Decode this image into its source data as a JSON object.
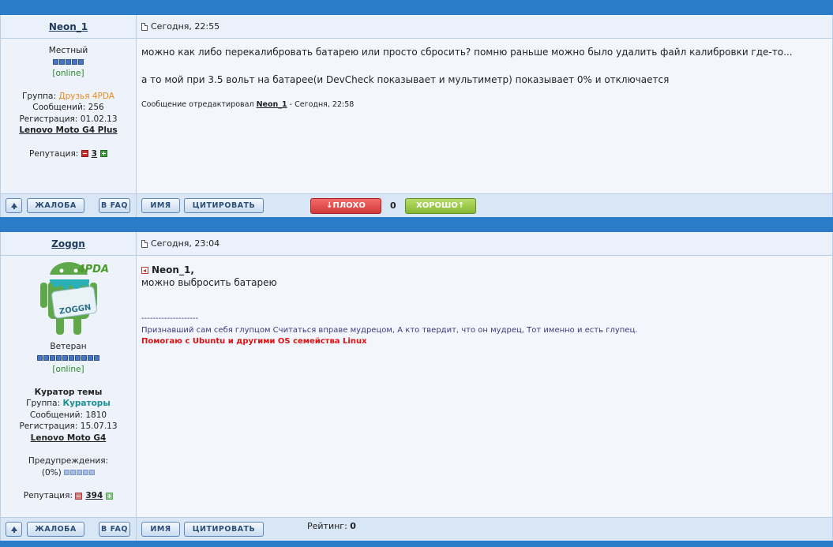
{
  "posts": [
    {
      "author": "Neon_1",
      "date": "Сегодня, 22:55",
      "rank": "Местный",
      "status": "[online]",
      "group_label": "Группа:",
      "group": "Друзья 4PDA",
      "messages_label": "Сообщений:",
      "messages": "256",
      "reg_label": "Регистрация:",
      "registration": "01.02.13",
      "device": "Lenovo Moto G4 Plus",
      "rep_label": "Репутация:",
      "reputation": "3",
      "body": [
        "можно как либо перекалибровать батарею или просто сбросить? помню раньше можно было удалить файл калибровки где-то...",
        "а то мой при 3.5 вольт на батарее(и DevCheck показывает и мультиметр) показывает 0% и отключается"
      ],
      "edited_prefix": "Сообщение отредактировал",
      "edited_by": "Neon_1",
      "edited_suffix": "- Сегодня, 22:58",
      "vote_bad": "ПЛОХО",
      "vote_count": "0",
      "vote_good": "ХОРОШО"
    },
    {
      "author": "Zoggn",
      "date": "Сегодня, 23:04",
      "avatar_text": "ZOGGN",
      "avatar_logo": "4PDA",
      "rank": "Ветеран",
      "status": "[online]",
      "title": "Куратор темы",
      "group_label": "Группа:",
      "group": "Кураторы",
      "messages_label": "Сообщений:",
      "messages": "1810",
      "reg_label": "Регистрация:",
      "registration": "15.07.13",
      "device": "Lenovo Moto G4",
      "warn_label": "Предупреждения:",
      "warn_value": "(0%)",
      "rep_label": "Репутация:",
      "reputation": "394",
      "quote_author": "Neon_1,",
      "body": [
        "можно выбросить батарею"
      ],
      "sig_line": "--------------------",
      "sig_text": "Признавший сам себя глупцом Считаться вправе мудрецом, А кто твердит, что он мудрец, Тот именно и есть глупец.",
      "sig_red": "Помогаю с Ubuntu и другими OS семейства Linux",
      "rating_label": "Рейтинг:",
      "rating": "0"
    }
  ],
  "buttons": {
    "complain": "ЖАЛОБА",
    "faq": "В FAQ",
    "name": "ИМЯ",
    "quote": "ЦИТИРОВАТЬ"
  },
  "colors": {
    "separator": "#2a7cc8",
    "bad": "#d23a3a",
    "good": "#86b832",
    "group_friends": "#e88b1a",
    "group_curators": "#1a8f8f"
  }
}
